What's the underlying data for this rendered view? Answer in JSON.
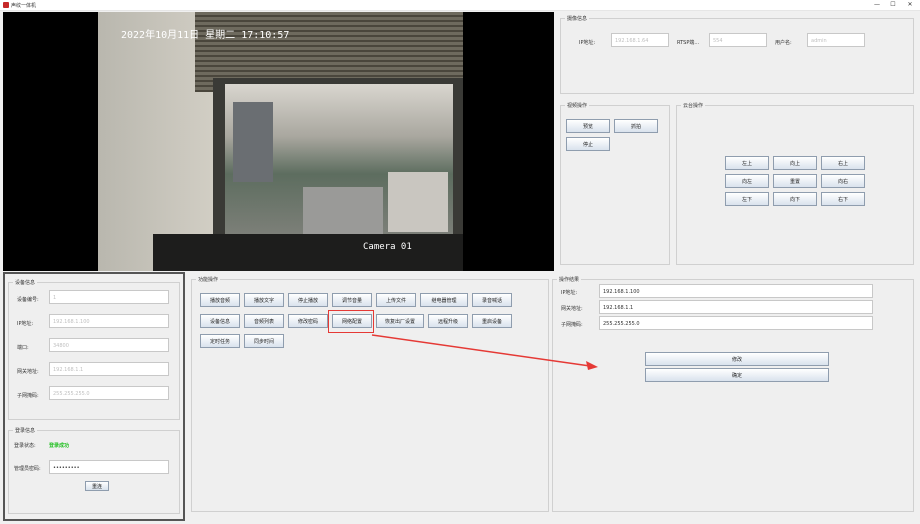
{
  "window": {
    "title": "声纹一体机",
    "min": "—",
    "max": "☐",
    "close": "✕"
  },
  "video": {
    "osd_datetime": "2022年10月11日 星期二 17:10:57",
    "osd_camera": "Camera 01"
  },
  "camera_info": {
    "title": "摄像信息",
    "ip_label": "IP地址:",
    "ip_value": "192.168.1.64",
    "rtsp_label": "RTSP端...",
    "rtsp_value": "554",
    "user_label": "用户名:",
    "user_value": "admin"
  },
  "video_ops": {
    "title": "视频操作",
    "preview": "预览",
    "snapshot": "抓拍",
    "stop": "停止"
  },
  "ptz": {
    "title": "云台操作",
    "buttons": [
      "左上",
      "向上",
      "右上",
      "向左",
      "重置",
      "向右",
      "左下",
      "向下",
      "右下"
    ]
  },
  "device_info": {
    "title": "设备信息",
    "device_no_label": "设备编号:",
    "device_no_value": "1",
    "ip_label": "IP地址:",
    "ip_value": "192.168.1.100",
    "port_label": "端口:",
    "port_value": "34800",
    "gateway_label": "网关地址:",
    "gateway_value": "192.168.1.1",
    "mask_label": "子网掩码:",
    "mask_value": "255.255.255.0"
  },
  "login": {
    "title": "登录信息",
    "status_label": "登录状态:",
    "status_value": "登录成功",
    "password_label": "管理员密码:",
    "password_value": "•••••••••",
    "submit": "重连"
  },
  "functions": {
    "title": "功能操作",
    "row1": [
      "播放音频",
      "播放文字",
      "停止播放",
      "调节音量",
      "上传文件",
      "继电器管理",
      "录音喊话"
    ],
    "row2": [
      "设备信息",
      "音频列表",
      "修改密码",
      "网络配置",
      "恢复出厂设置",
      "远程升级",
      "重启设备"
    ],
    "row3": [
      "定时任务",
      "同步时间"
    ]
  },
  "result": {
    "title": "操作结果",
    "ip_label": "IP地址:",
    "ip_value": "192.168.1.100",
    "gateway_label": "网关地址:",
    "gateway_value": "192.168.1.1",
    "mask_label": "子网掩码:",
    "mask_value": "255.255.255.0",
    "modify": "修改",
    "confirm": "确定"
  },
  "colors": {
    "accent": "#e53935",
    "status_ok": "#23c023",
    "button_border": "#8f9dae"
  }
}
